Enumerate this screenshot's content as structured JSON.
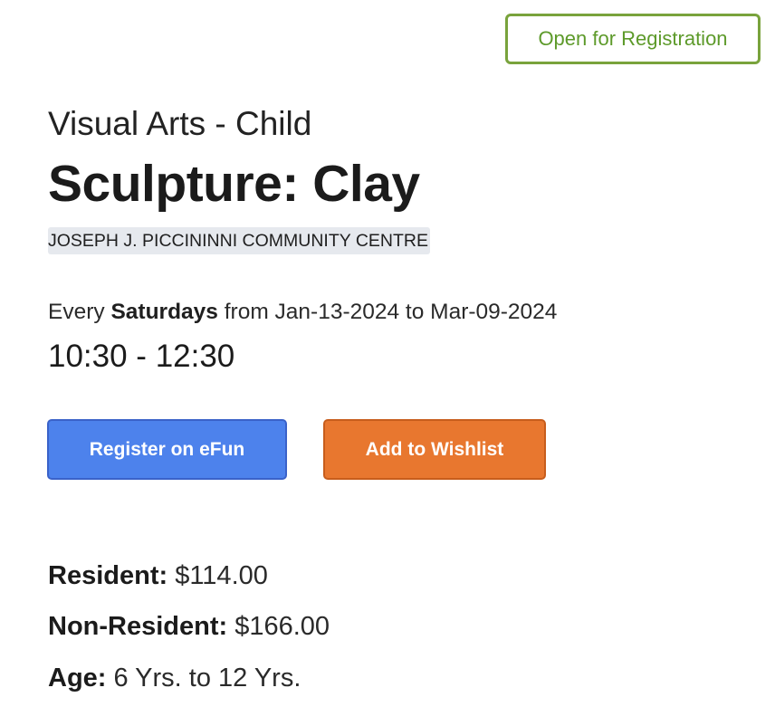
{
  "status": {
    "label": "Open for Registration",
    "color": "#79a33c"
  },
  "program": {
    "category": "Visual Arts - Child",
    "title": "Sculpture: Clay",
    "location": "JOSEPH J. PICCININNI COMMUNITY CENTRE"
  },
  "schedule": {
    "prefix": "Every",
    "day": "Saturdays",
    "range": "from Jan-13-2024 to Mar-09-2024",
    "time": "10:30 - 12:30"
  },
  "actions": {
    "register_label": "Register on eFun",
    "register_color": "#4d82ec",
    "wishlist_label": "Add to Wishlist",
    "wishlist_color": "#e8772f"
  },
  "details": {
    "resident_label": "Resident:",
    "resident_value": "$114.00",
    "nonresident_label": "Non-Resident:",
    "nonresident_value": "$166.00",
    "age_label": "Age:",
    "age_value": "6 Yrs. to 12 Yrs."
  }
}
